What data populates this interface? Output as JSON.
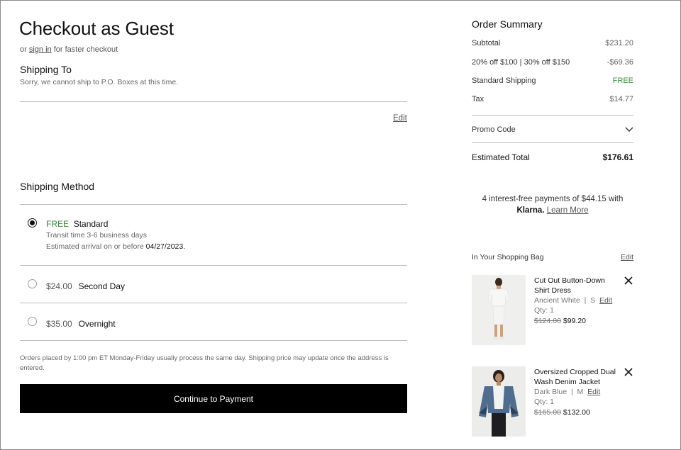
{
  "checkout": {
    "title": "Checkout as Guest",
    "signin_prefix": "or",
    "signin_link": "sign in",
    "signin_suffix": "for faster checkout"
  },
  "shipping_to": {
    "heading": "Shipping To",
    "notice": "Sorry, we cannot ship to P.O. Boxes at this time.",
    "edit_label": "Edit"
  },
  "shipping_method": {
    "heading": "Shipping Method",
    "options": [
      {
        "price": "FREE",
        "name": "Standard",
        "transit": "Transit time 3-6 business days",
        "arrival_prefix": "Estimated arrival on or before",
        "arrival_date": "04/27/2023.",
        "selected": true
      },
      {
        "price": "$24.00",
        "name": "Second Day",
        "selected": false
      },
      {
        "price": "$35.00",
        "name": "Overnight",
        "selected": false
      }
    ],
    "note": "Orders placed by 1:00 pm ET Monday-Friday usually process the same day. Shipping price may update once the address is entered.",
    "continue_label": "Continue to Payment"
  },
  "order_summary": {
    "heading": "Order Summary",
    "rows": [
      {
        "label": "Subtotal",
        "value": "$231.20"
      },
      {
        "label": "20% off $100 | 30% off $150",
        "value": "-$69.36"
      },
      {
        "label": "Standard Shipping",
        "value": "FREE"
      },
      {
        "label": "Tax",
        "value": "$14.77"
      }
    ],
    "promo_label": "Promo Code",
    "total_label": "Estimated Total",
    "total_value": "$176.61",
    "klarna_text": "4 interest-free payments of $44.15 with",
    "klarna_brand": "Klarna.",
    "klarna_link": "Learn More",
    "free_color": "#3a8a3a"
  },
  "bag": {
    "heading": "In Your Shopping Bag",
    "edit_label": "Edit",
    "items": [
      {
        "title": "Cut Out Button-Down Shirt Dress",
        "color": "Ancient White",
        "size": "S",
        "edit_label": "Edit",
        "qty": "Qty: 1",
        "orig_price": "$124.00",
        "sale_price": "$99.20"
      },
      {
        "title": "Oversized Cropped Dual Wash Denim Jacket",
        "color": "Dark Blue",
        "size": "M",
        "edit_label": "Edit",
        "qty": "Qty: 1",
        "orig_price": "$165.00",
        "sale_price": "$132.00"
      }
    ]
  }
}
